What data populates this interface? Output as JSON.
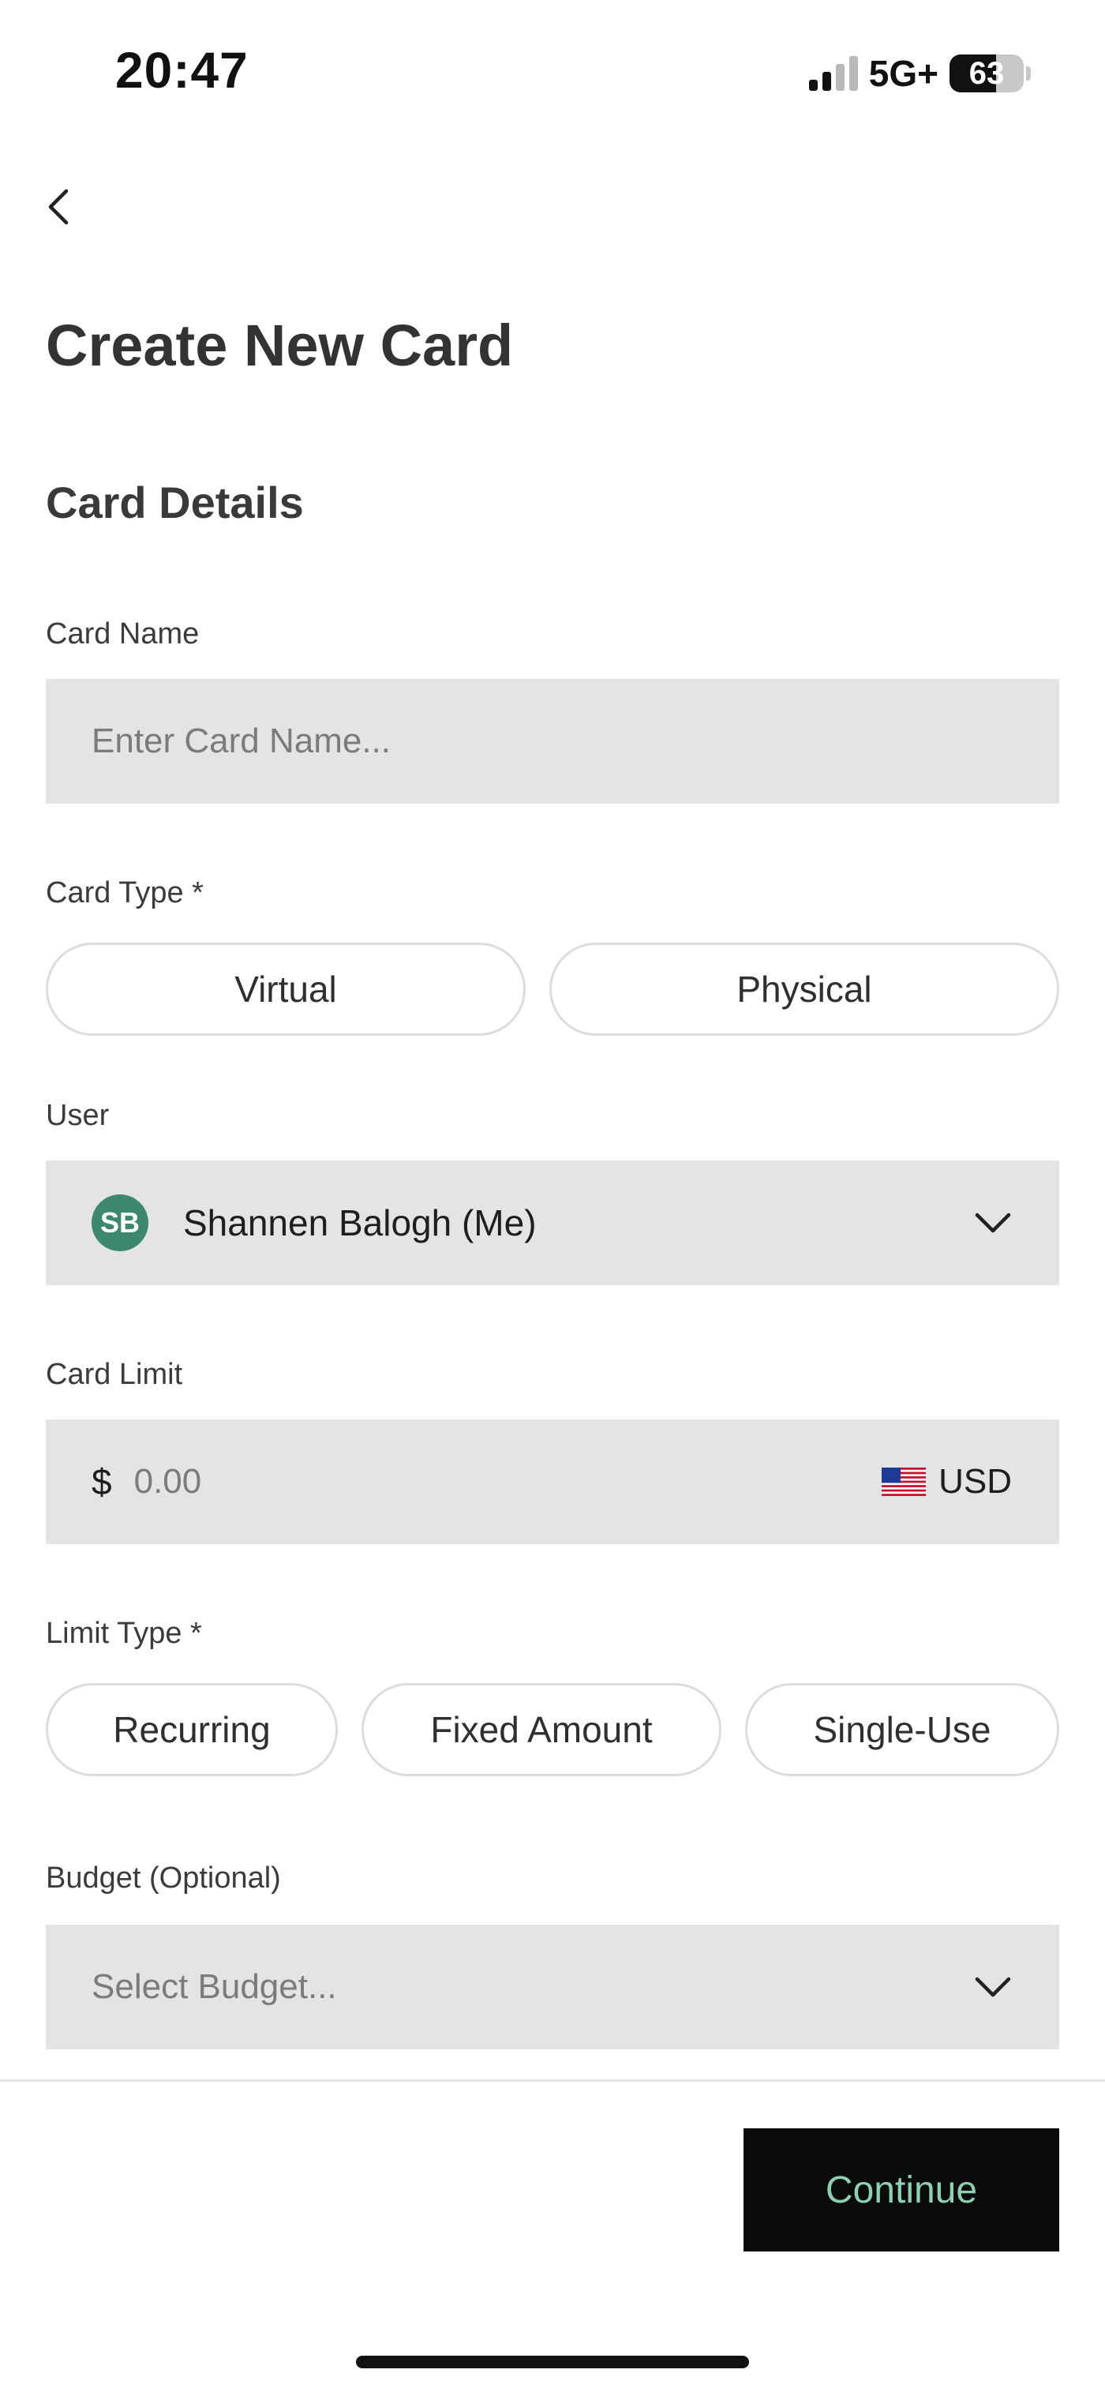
{
  "status_bar": {
    "time": "20:47",
    "network": "5G+",
    "battery": "63",
    "battery_level": 0.63,
    "signal_bars_active": 2,
    "signal_bars_total": 4
  },
  "header": {
    "back_icon": "chevron-left-icon",
    "title": "Create New Card"
  },
  "form": {
    "section_title": "Card Details",
    "card_name": {
      "label": "Card Name",
      "placeholder": "Enter Card Name..."
    },
    "card_type": {
      "label": "Card Type *",
      "options": [
        "Virtual",
        "Physical"
      ]
    },
    "user": {
      "label": "User",
      "avatar_initials": "SB",
      "avatar_color": "#3e8770",
      "selected": "Shannen Balogh (Me)",
      "icon": "chevron-down-icon"
    },
    "card_limit": {
      "label": "Card Limit",
      "currency_symbol": "$",
      "placeholder": "0.00",
      "currency": "USD",
      "flag_icon": "us-flag-icon"
    },
    "limit_type": {
      "label": "Limit Type *",
      "options": [
        "Recurring",
        "Fixed Amount",
        "Single-Use"
      ]
    },
    "budget": {
      "label": "Budget (Optional)",
      "placeholder": "Select Budget...",
      "icon": "chevron-down-icon"
    }
  },
  "footer": {
    "continue_label": "Continue",
    "continue_bg": "#0b0b0b",
    "continue_text_color": "#8fd0b3"
  }
}
